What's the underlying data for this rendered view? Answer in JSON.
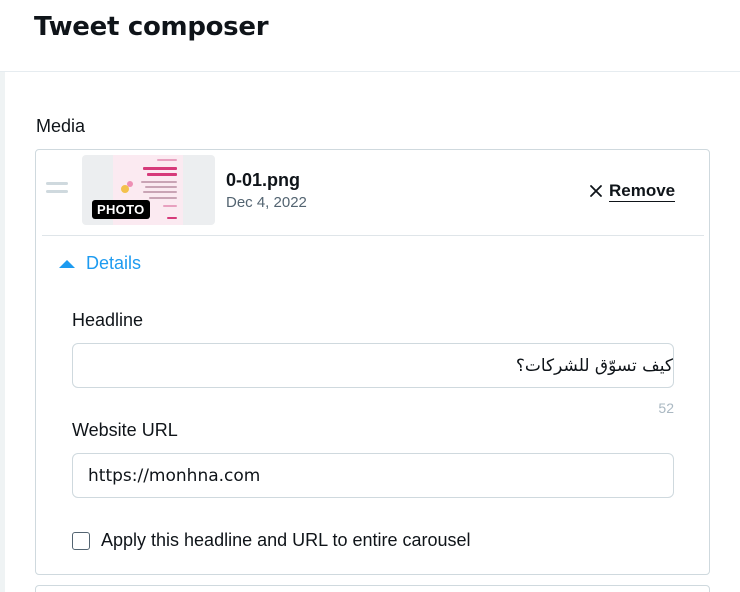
{
  "header": {
    "title": "Tweet composer"
  },
  "media": {
    "section_label": "Media",
    "item": {
      "badge": "PHOTO",
      "file_name": "0-01.png",
      "date": "Dec 4, 2022",
      "remove_label": "Remove"
    },
    "details": {
      "toggle_label": "Details",
      "headline_label": "Headline",
      "headline_value": "كيف تسوّق للشركات؟",
      "headline_char_count": "52",
      "website_label": "Website URL",
      "website_value": "https://monhna.com",
      "carousel_checkbox_label": "Apply this headline and URL to entire carousel",
      "carousel_checkbox_checked": false
    }
  },
  "colors": {
    "accent": "#1d9bf0",
    "text": "#0f1419",
    "muted": "#536471",
    "border": "#cfd9de"
  },
  "icons": {
    "drag": "drag-handle-icon",
    "remove": "close-icon",
    "details": "chevron-up-icon"
  }
}
